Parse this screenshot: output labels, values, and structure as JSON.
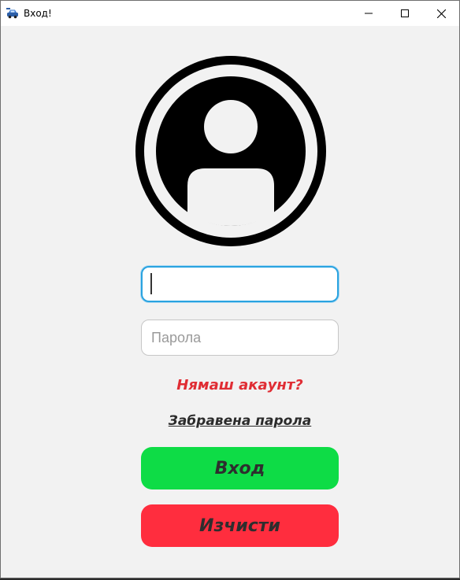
{
  "window": {
    "title": "Вход!",
    "icon": "car-app-icon",
    "controls": [
      "minimize-icon",
      "maximize-icon",
      "close-icon"
    ]
  },
  "form": {
    "avatar_icon": "user-avatar-icon",
    "username": {
      "value": "",
      "placeholder": ""
    },
    "password": {
      "value": "",
      "placeholder": "Парола"
    },
    "no_account_label": "Нямаш акаунт?",
    "forgot_password_label": "Забравена парола",
    "login_button_label": "Вход",
    "clear_button_label": "Изчисти"
  },
  "colors": {
    "login_button": "#0edc46",
    "clear_button": "#ff2d3e",
    "no_account_text": "#e02d34",
    "focus_border": "#2aa3e0"
  }
}
